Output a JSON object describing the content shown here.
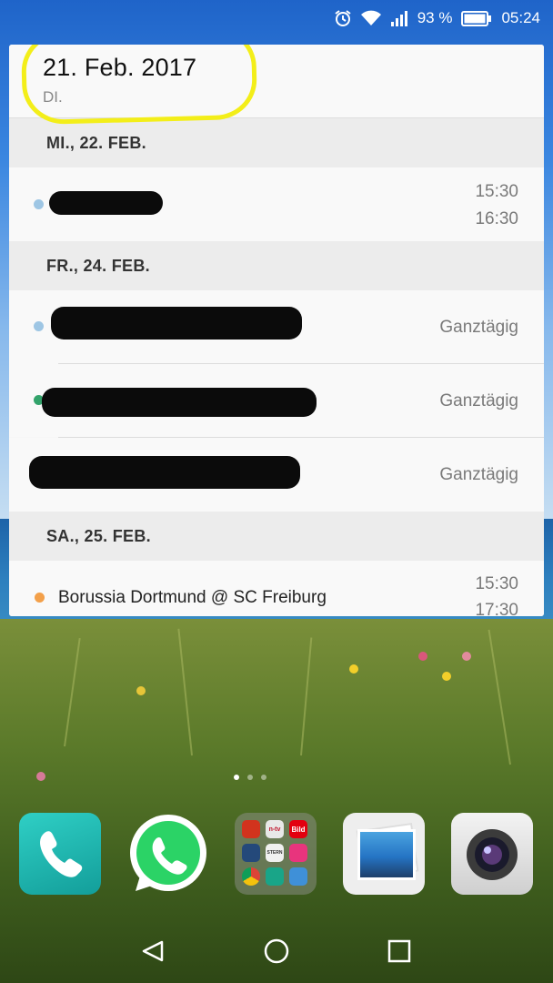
{
  "status_bar": {
    "battery_percent": "93 %",
    "time": "05:24",
    "icons": [
      "alarm-icon",
      "wifi-icon",
      "signal-icon",
      "battery-icon"
    ]
  },
  "widget": {
    "date": "21. Feb. 2017",
    "weekday": "DI.",
    "days": [
      {
        "label": "MI., 22. FEB.",
        "events": [
          {
            "dot_color": "#9ec6e4",
            "start": "15:30",
            "end": "16:30",
            "title_redacted": true
          }
        ]
      },
      {
        "label": "FR., 24. FEB.",
        "events": [
          {
            "dot_color": "#9ec6e4",
            "time": "Ganztägig",
            "title_redacted": true
          },
          {
            "dot_color": "#33a36b",
            "time": "Ganztägig",
            "title_redacted": true
          },
          {
            "dot_color": "",
            "time": "Ganztägig",
            "title_redacted": true
          }
        ]
      },
      {
        "label": "SA., 25. FEB.",
        "events": [
          {
            "dot_color": "#f3a04a",
            "title": "Borussia Dortmund @ SC Freiburg",
            "start": "15:30",
            "end": "17:30"
          }
        ]
      }
    ]
  },
  "home": {
    "page_count": 3,
    "active_page": 1,
    "dock_apps": [
      "phone-app-icon",
      "whatsapp-app-icon",
      "app-folder-icon",
      "gallery-app-icon",
      "camera-app-icon"
    ],
    "folder_apps": [
      "browser",
      "n-tv",
      "bild",
      "news",
      "stern",
      "mail",
      "chrome",
      "docs",
      "messages"
    ],
    "folder_labels": {
      "ntv": "n-tv",
      "bild": "Bild",
      "stern": "STERN"
    }
  },
  "colors": {
    "highlight": "#f3ee19",
    "accent_teal": "#2ac0b9",
    "whatsapp_green": "#2bd366"
  }
}
